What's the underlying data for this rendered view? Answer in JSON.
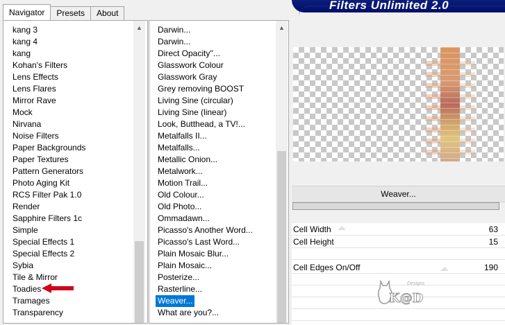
{
  "tabs": [
    {
      "label": "Navigator"
    },
    {
      "label": "Presets"
    },
    {
      "label": "About"
    }
  ],
  "banner": {
    "title": "Filters Unlimited 2.0"
  },
  "categories": [
    "kang 3",
    "kang 4",
    "kang",
    "Kohan's Filters",
    "Lens Effects",
    "Lens Flares",
    "Mirror Rave",
    "Mock",
    "Nirvana",
    "Noise Filters",
    "Paper Backgrounds",
    "Paper Textures",
    "Pattern Generators",
    "Photo Aging Kit",
    "RCS Filter Pak 1.0",
    "Render",
    "Sapphire Filters 1c",
    "Simple",
    "Special Effects 1",
    "Special Effects 2",
    "Sybia",
    "Tile & Mirror",
    "Toadies",
    "Tramages",
    "Transparency"
  ],
  "filters": [
    "Darwin...",
    "Darwin...",
    "Direct Opacity''...",
    "Glasswork Colour",
    "Glasswork Gray",
    "Grey removing BOOST",
    "Living Sine (circular)",
    "Living Sine (linear)",
    "Look, Butthead, a TV!...",
    "Metalfalls II...",
    "Metalfalls...",
    "Metallic Onion...",
    "Metalwork...",
    "Motion Trail...",
    "Old Colour...",
    "Old Photo...",
    "Ommadawn...",
    "Picasso's Another Word...",
    "Picasso's Last Word...",
    "Plain Mosaic Blur...",
    "Plain Mosaic...",
    "Posterize...",
    "Rasterline...",
    "Weaver...",
    "What are you?..."
  ],
  "selected_filter_index": 23,
  "highlighted_category": "Toadies",
  "filter_title": "Weaver...",
  "params": [
    {
      "label": "Cell Width",
      "value": "63"
    },
    {
      "label": "Cell Height",
      "value": "15"
    },
    {
      "label": "Cell Edges On/Off",
      "value": "190"
    }
  ],
  "watermark": {
    "text": "K@D",
    "small": "Designs"
  },
  "colors": {
    "selection": "#0078d7",
    "banner": "#0a1a78",
    "arrow": "#d0021b"
  }
}
